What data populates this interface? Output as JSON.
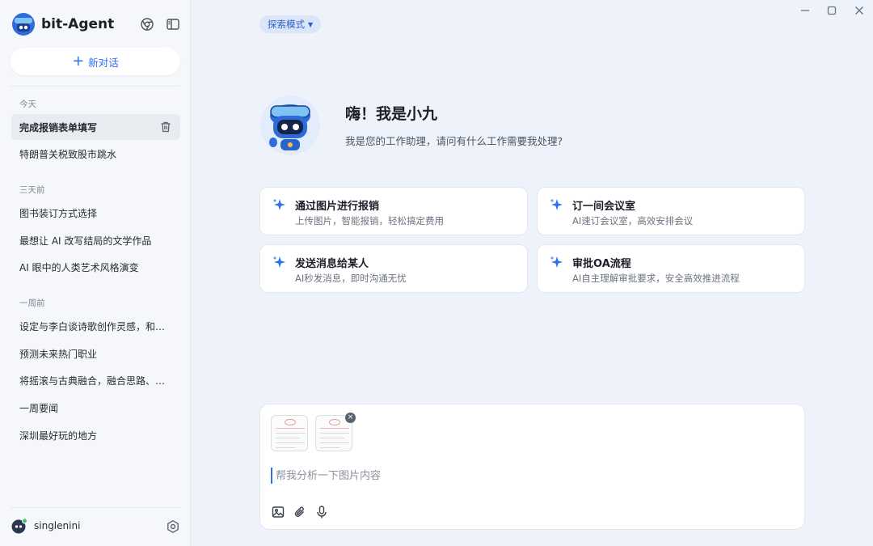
{
  "app": {
    "name": "bit-Agent"
  },
  "sidebar": {
    "new_chat_label": "新对话",
    "groups": [
      {
        "label": "今天",
        "items": [
          {
            "title": "完成报销表单填写",
            "active": true
          },
          {
            "title": "特朗普关税致股市跳水"
          }
        ]
      },
      {
        "label": "三天前",
        "items": [
          {
            "title": "图书装订方式选择"
          },
          {
            "title": "最想让 AI 改写结局的文学作品"
          },
          {
            "title": "AI 眼中的人类艺术风格演变"
          }
        ]
      },
      {
        "label": "一周前",
        "items": [
          {
            "title": "设定与李白谈诗歌创作灵感，和爱…"
          },
          {
            "title": "预测未来热门职业"
          },
          {
            "title": "将摇滚与古典融合，融合思路、乐…"
          },
          {
            "title": "一周要闻"
          },
          {
            "title": "深圳最好玩的地方"
          }
        ]
      }
    ],
    "user": {
      "name": "singlenini"
    }
  },
  "main": {
    "mode_label": "探索模式",
    "greeting": "嗨！我是小九",
    "subtitle": "我是您的工作助理，请问有什么工作需要我处理?",
    "cards": [
      {
        "title": "通过图片进行报销",
        "desc": "上传图片，智能报销，轻松搞定费用"
      },
      {
        "title": "订一间会议室",
        "desc": "AI速订会议室，高效安排会议"
      },
      {
        "title": "发送消息给某人",
        "desc": "AI秒发消息，即时沟通无忧"
      },
      {
        "title": "审批OA流程",
        "desc": "AI自主理解审批要求，安全高效推进流程"
      }
    ],
    "composer": {
      "placeholder": "帮我分析一下图片内容",
      "value": ""
    }
  },
  "colors": {
    "accent": "#2b6ff2",
    "sidebar_bg": "#f5f7fa",
    "main_bg": "#eef3fb"
  },
  "icons": [
    "robot-logo-icon",
    "chrome-icon",
    "sidebar-toggle-icon",
    "plus-icon",
    "trash-icon",
    "settings-icon",
    "sparkle-icon",
    "image-icon",
    "paperclip-icon",
    "microphone-icon",
    "minimize-icon",
    "maximize-icon",
    "close-icon"
  ]
}
